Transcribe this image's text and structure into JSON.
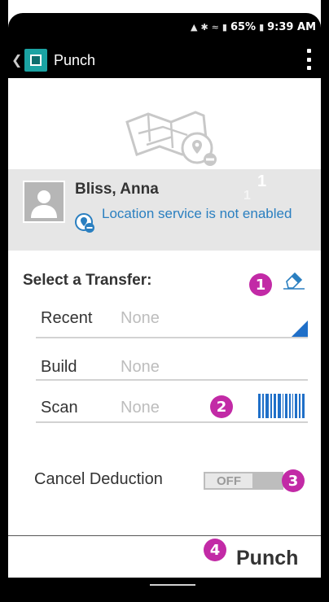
{
  "status_bar": {
    "icons": [
      "alarm-icon",
      "bluetooth-icon",
      "wifi-icon",
      "signal-icon"
    ],
    "battery": "65%",
    "time": "9:39 AM"
  },
  "app_bar": {
    "title": "Punch",
    "logo_color": "#1ba3a3"
  },
  "user": {
    "name": "Bliss, Anna",
    "location_status": "Location service is not enabled",
    "overlay_count_large": "1",
    "overlay_count_small": "1"
  },
  "transfer": {
    "title": "Select a Transfer:",
    "rows": [
      {
        "label": "Recent",
        "value": "None",
        "control": "dropdown"
      },
      {
        "label": "Build",
        "value": "None",
        "control": "none"
      },
      {
        "label": "Scan",
        "value": "None",
        "control": "barcode"
      }
    ]
  },
  "cancel_deduction": {
    "label": "Cancel Deduction",
    "toggle_state": "OFF"
  },
  "callouts": [
    "1",
    "2",
    "3",
    "4"
  ],
  "footer": {
    "punch_label": "Punch"
  },
  "colors": {
    "accent_blue": "#1f6fc8",
    "link_blue": "#2a7fc0",
    "callout_magenta": "#c22aa6",
    "band_gray": "#e6e6e6"
  }
}
